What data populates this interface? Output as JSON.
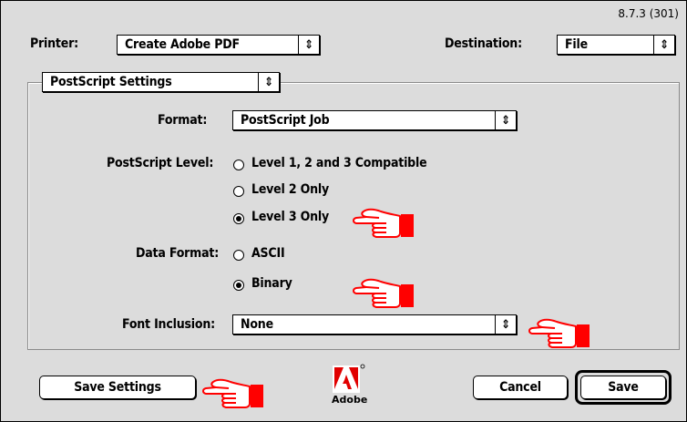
{
  "version": "8.7.3 (301)",
  "printer": {
    "label": "Printer:",
    "value": "Create Adobe PDF"
  },
  "destination": {
    "label": "Destination:",
    "value": "File"
  },
  "panel_selector": {
    "value": "PostScript Settings"
  },
  "format": {
    "label": "Format:",
    "value": "PostScript Job"
  },
  "postscript_level": {
    "label": "PostScript Level:",
    "options": [
      "Level 1, 2 and 3 Compatible",
      "Level 2 Only",
      "Level 3 Only"
    ],
    "selected": "Level 3 Only"
  },
  "data_format": {
    "label": "Data Format:",
    "options": [
      "ASCII",
      "Binary"
    ],
    "selected": "Binary"
  },
  "font_inclusion": {
    "label": "Font Inclusion:",
    "value": "None"
  },
  "buttons": {
    "save_settings": "Save Settings",
    "cancel": "Cancel",
    "save": "Save"
  },
  "logo": {
    "text": "Adobe"
  },
  "icons": {
    "popup_arrow": "updown-arrows-icon",
    "pointer": "pointing-hand-icon"
  },
  "colors": {
    "pointer": "#ff0000",
    "dialog_bg": "#dcdcdc"
  }
}
